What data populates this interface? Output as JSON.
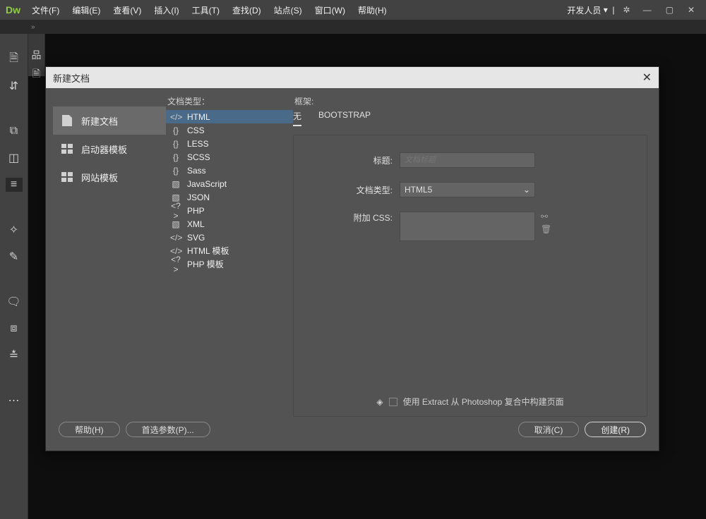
{
  "menubar": {
    "logo": "Dw",
    "items": [
      "文件(F)",
      "编辑(E)",
      "查看(V)",
      "插入(I)",
      "工具(T)",
      "查找(D)",
      "站点(S)",
      "窗口(W)",
      "帮助(H)"
    ],
    "dev_label": "开发人员"
  },
  "dialog": {
    "title": "新建文档",
    "categories": [
      {
        "label": "新建文档",
        "selected": true,
        "icon": "doc"
      },
      {
        "label": "启动器模板",
        "selected": false,
        "icon": "tiles"
      },
      {
        "label": "网站模板",
        "selected": false,
        "icon": "tiles"
      }
    ],
    "doc_type_label": "文档类型：",
    "doc_types": [
      {
        "label": "HTML",
        "icon": "</>",
        "selected": true
      },
      {
        "label": "CSS",
        "icon": "{}",
        "selected": false
      },
      {
        "label": "LESS",
        "icon": "{}",
        "selected": false
      },
      {
        "label": "SCSS",
        "icon": "{}",
        "selected": false
      },
      {
        "label": "Sass",
        "icon": "{}",
        "selected": false
      },
      {
        "label": "JavaScript",
        "icon": "▧",
        "selected": false
      },
      {
        "label": "JSON",
        "icon": "▧",
        "selected": false
      },
      {
        "label": "PHP",
        "icon": "<?>",
        "selected": false
      },
      {
        "label": "XML",
        "icon": "▧",
        "selected": false
      },
      {
        "label": "SVG",
        "icon": "</>",
        "selected": false
      },
      {
        "label": "HTML 模板",
        "icon": "</>",
        "selected": false
      },
      {
        "label": "PHP 模板",
        "icon": "<?>",
        "selected": false
      }
    ],
    "framework_label": "框架:",
    "framework_tabs": [
      {
        "label": "无",
        "active": true
      },
      {
        "label": "BOOTSTRAP",
        "active": false
      }
    ],
    "form": {
      "title_label": "标题:",
      "title_placeholder": "文档标题",
      "doctype_label": "文档类型:",
      "doctype_value": "HTML5",
      "css_label": "附加 CSS:",
      "extract_label": "使用 Extract 从 Photoshop 复合中构建页面"
    },
    "buttons": {
      "help": "帮助(H)",
      "prefs": "首选参数(P)...",
      "cancel": "取消(C)",
      "create": "创建(R)"
    }
  }
}
